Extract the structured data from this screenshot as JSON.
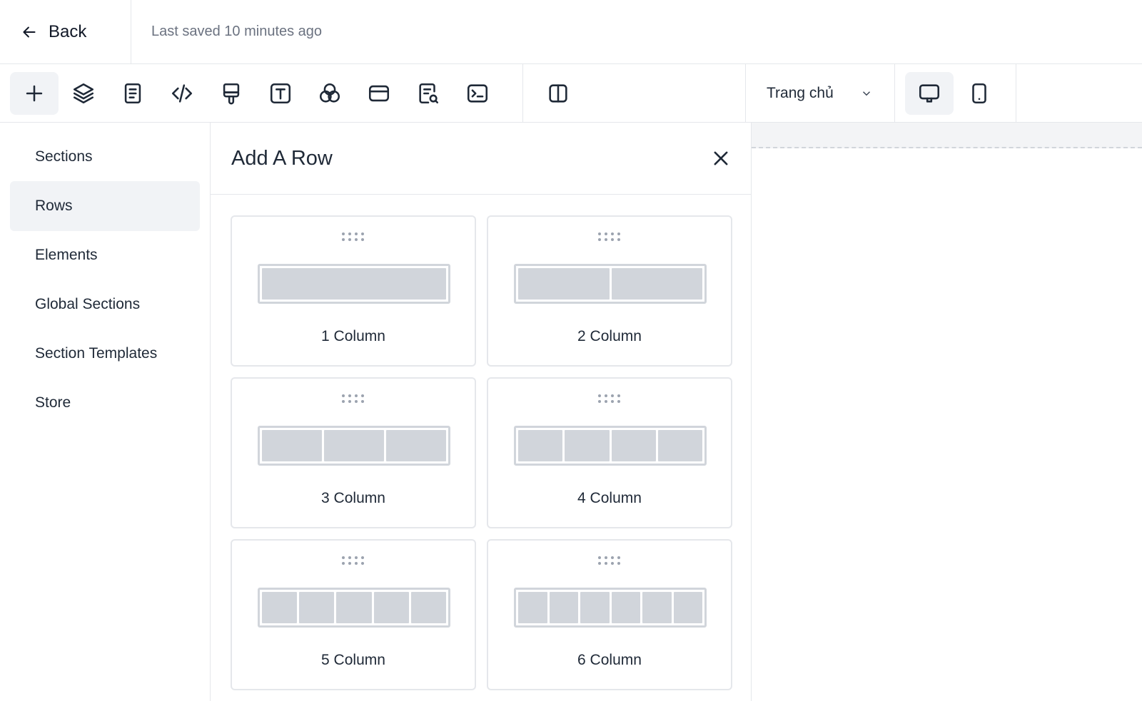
{
  "header": {
    "back_label": "Back",
    "saved_text": "Last saved 10 minutes ago"
  },
  "toolbar": {
    "tools": [
      {
        "icon": "plus-icon",
        "active": true
      },
      {
        "icon": "layers-icon"
      },
      {
        "icon": "document-icon"
      },
      {
        "icon": "code-icon"
      },
      {
        "icon": "paint-brush-icon"
      },
      {
        "icon": "text-icon"
      },
      {
        "icon": "color-circles-icon"
      },
      {
        "icon": "browser-window-icon"
      },
      {
        "icon": "document-search-icon"
      },
      {
        "icon": "terminal-icon"
      },
      {
        "icon": "split-view-icon"
      }
    ],
    "page_select": {
      "value": "Trang chủ"
    },
    "devices": [
      {
        "icon": "desktop-icon",
        "active": true
      },
      {
        "icon": "mobile-icon"
      }
    ]
  },
  "sidebar": {
    "items": [
      {
        "label": "Sections"
      },
      {
        "label": "Rows",
        "active": true
      },
      {
        "label": "Elements"
      },
      {
        "label": "Global Sections"
      },
      {
        "label": "Section Templates"
      },
      {
        "label": "Store"
      }
    ]
  },
  "panel": {
    "title": "Add A Row",
    "rows": [
      {
        "label": "1 Column",
        "columns": 1
      },
      {
        "label": "2 Column",
        "columns": 2
      },
      {
        "label": "3 Column",
        "columns": 3
      },
      {
        "label": "4 Column",
        "columns": 4
      },
      {
        "label": "5 Column",
        "columns": 5
      },
      {
        "label": "6 Column",
        "columns": 6
      }
    ]
  },
  "colors": {
    "accent_bg": "#f1f3f6",
    "border": "#e5e7eb",
    "preview": "#d1d5db",
    "text": "#1f2937",
    "muted_text": "#6b7280"
  }
}
